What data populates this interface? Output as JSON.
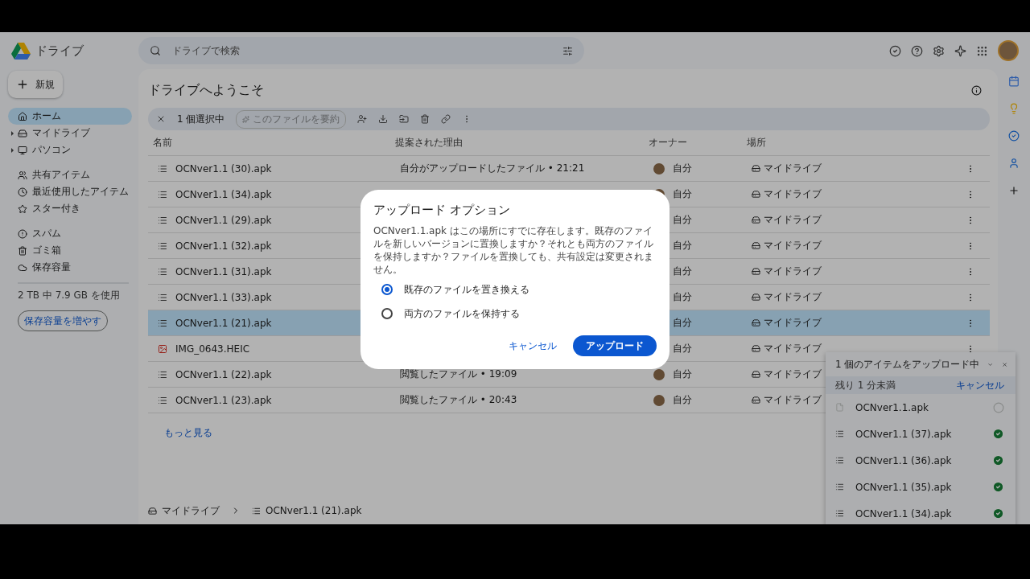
{
  "app": {
    "name": "ドライブ"
  },
  "search": {
    "placeholder": "ドライブで検索"
  },
  "new_button": {
    "label": "新規"
  },
  "sidebar": {
    "items": [
      {
        "kind": "home",
        "label": "ホーム",
        "selected": true,
        "expandable": false
      },
      {
        "kind": "drive",
        "label": "マイドライブ",
        "selected": false,
        "expandable": true
      },
      {
        "kind": "computer",
        "label": "パソコン",
        "selected": false,
        "expandable": true
      },
      {
        "kind": "shared",
        "label": "共有アイテム",
        "selected": false,
        "expandable": false
      },
      {
        "kind": "recent",
        "label": "最近使用したアイテム",
        "selected": false,
        "expandable": false
      },
      {
        "kind": "starred",
        "label": "スター付き",
        "selected": false,
        "expandable": false
      },
      {
        "kind": "spam",
        "label": "スパム",
        "selected": false,
        "expandable": false
      },
      {
        "kind": "trash",
        "label": "ゴミ箱",
        "selected": false,
        "expandable": false
      },
      {
        "kind": "storage",
        "label": "保存容量",
        "selected": false,
        "expandable": false
      }
    ],
    "storage_text": "2 TB 中 7.9 GB を使用",
    "storage_button": "保存容量を増やす"
  },
  "main": {
    "title": "ドライブへようこそ",
    "selection_bar": {
      "count": "1 個選択中",
      "summarize": "このファイルを要約"
    },
    "table": {
      "columns": [
        "名前",
        "提案された理由",
        "オーナー",
        "場所"
      ],
      "rows": [
        {
          "kind": "apk",
          "name": "OCNver1.1 (30).apk",
          "reason": "自分がアップロードしたファイル • 21:21",
          "owner": "自分",
          "location": "マイドライブ",
          "selected": false
        },
        {
          "kind": "apk",
          "name": "OCNver1.1 (34).apk",
          "owner": "自分",
          "location": "マイドライブ",
          "selected": false
        },
        {
          "kind": "apk",
          "name": "OCNver1.1 (29).apk",
          "owner": "自分",
          "location": "マイドライブ",
          "selected": false
        },
        {
          "kind": "apk",
          "name": "OCNver1.1 (32).apk",
          "owner": "自分",
          "location": "マイドライブ",
          "selected": false
        },
        {
          "kind": "apk",
          "name": "OCNver1.1 (31).apk",
          "owner": "自分",
          "location": "マイドライブ",
          "selected": false
        },
        {
          "kind": "apk",
          "name": "OCNver1.1 (33).apk",
          "owner": "自分",
          "location": "マイドライブ",
          "selected": false
        },
        {
          "kind": "apk",
          "name": "OCNver1.1 (21).apk",
          "owner": "自分",
          "location": "マイドライブ",
          "selected": true
        },
        {
          "kind": "image",
          "name": "IMG_0643.HEIC",
          "owner": "自分",
          "location": "マイドライブ",
          "selected": false
        },
        {
          "kind": "apk",
          "name": "OCNver1.1 (22).apk",
          "reason": "閲覧したファイル • 19:09",
          "owner": "自分",
          "location": "マイドライブ",
          "selected": false
        },
        {
          "kind": "apk",
          "name": "OCNver1.1 (23).apk",
          "reason": "閲覧したファイル • 20:43",
          "owner": "自分",
          "location": "マイドライブ",
          "selected": false
        }
      ]
    },
    "more_link": "もっと見る",
    "breadcrumb": [
      "マイドライブ",
      "OCNver1.1 (21).apk"
    ]
  },
  "upload_panel": {
    "title": "1 個のアイテムをアップロード中",
    "remaining": "残り 1 分未満",
    "cancel": "キャンセル",
    "items": [
      {
        "kind": "file",
        "name": "OCNver1.1.apk",
        "done": false
      },
      {
        "kind": "apk",
        "name": "OCNver1.1 (37).apk",
        "done": true
      },
      {
        "kind": "apk",
        "name": "OCNver1.1 (36).apk",
        "done": true
      },
      {
        "kind": "apk",
        "name": "OCNver1.1 (35).apk",
        "done": true
      },
      {
        "kind": "apk",
        "name": "OCNver1.1 (34).apk",
        "done": true
      }
    ]
  },
  "dialog": {
    "title": "アップロード オプション",
    "message": "OCNver1.1.apk はこの場所にすでに存在します。既存のファイルを新しいバージョンに置換しますか？それとも両方のファイルを保持しますか？ファイルを置換しても、共有設定は変更されません。",
    "options": [
      {
        "label": "既存のファイルを置き換える",
        "selected": true
      },
      {
        "label": "両方のファイルを保持する",
        "selected": false
      }
    ],
    "cancel": "キャンセル",
    "confirm": "アップロード"
  }
}
